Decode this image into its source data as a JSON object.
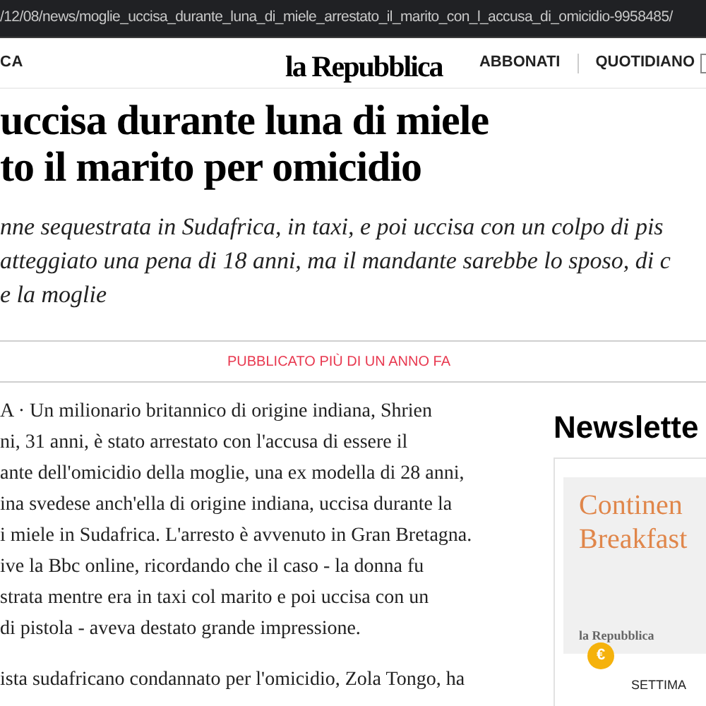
{
  "url": "/12/08/news/moglie_uccisa_durante_luna_di_miele_arrestato_il_marito_con_l_accusa_di_omicidio-9958485/",
  "header": {
    "section": "CA",
    "logo": "la Repubblica",
    "links": [
      "ABBONATI",
      "QUOTIDIANO"
    ]
  },
  "headline": [
    "uccisa durante luna di miele",
    "to il marito per omicidio"
  ],
  "summary": [
    "nne sequestrata in Sudafrica, in taxi, e poi uccisa con un colpo di pis",
    "atteggiato una pena di 18 anni, ma il mandante sarebbe lo sposo, di c",
    "e la moglie"
  ],
  "published": "PUBBLICATO PIÙ DI UN ANNO FA",
  "body": [
    [
      "A · Un milionario britannico di origine indiana, Shrien",
      "ni, 31 anni, è stato arrestato con l'accusa di essere il",
      "ante dell'omicidio della moglie, una ex modella di 28 anni,",
      "ina svedese anch'ella di origine indiana, uccisa durante la",
      "i miele in Sudafrica. L'arresto è avvenuto in Gran Bretagna.",
      "ive la Bbc online, ricordando che il caso - la donna fu",
      "strata mentre era in taxi col marito e poi uccisa con un",
      "di pistola - aveva destato grande impressione."
    ],
    [
      "ista sudafricano condannato per l'omicidio, Zola Tongo, ha"
    ]
  ],
  "sidebar": {
    "title": "Newslette",
    "card": {
      "title_lines": [
        "Continen",
        "Breakfast"
      ],
      "brand": "la Repubblica",
      "badge": "€",
      "label": "SETTIMA"
    }
  }
}
